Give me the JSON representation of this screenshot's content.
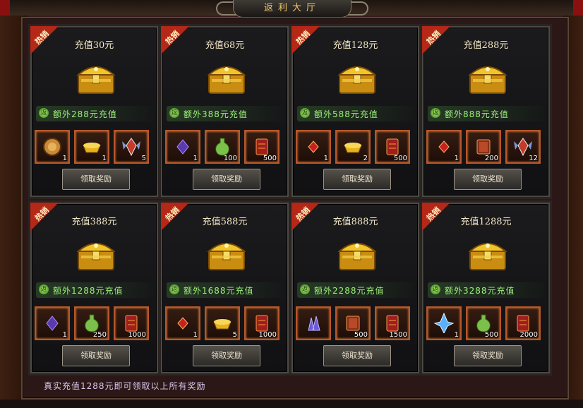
{
  "title": "返利大厅",
  "hot_label": "热销",
  "claim_label": "领取奖励",
  "footer_text": "真实充值1288元即可领取以上所有奖励",
  "cards": [
    {
      "charge": "充值30元",
      "bonus": "额外288元充值",
      "items": [
        {
          "icon": "coin-icon",
          "count": "1"
        },
        {
          "icon": "gold-ingot-icon",
          "count": "1"
        },
        {
          "icon": "winged-emblem-icon",
          "count": "5"
        }
      ]
    },
    {
      "charge": "充值68元",
      "bonus": "额外388元充值",
      "items": [
        {
          "icon": "purple-gem-icon",
          "count": "1"
        },
        {
          "icon": "green-potion-icon",
          "count": "100"
        },
        {
          "icon": "red-scroll-icon",
          "count": "500"
        }
      ]
    },
    {
      "charge": "充值128元",
      "bonus": "额外588元充值",
      "items": [
        {
          "icon": "red-gem-icon",
          "count": "1"
        },
        {
          "icon": "gold-ingot-icon",
          "count": "2"
        },
        {
          "icon": "red-scroll-icon",
          "count": "500"
        }
      ]
    },
    {
      "charge": "充值288元",
      "bonus": "额外888元充值",
      "items": [
        {
          "icon": "red-gem-icon",
          "count": "1"
        },
        {
          "icon": "book-icon",
          "count": "200"
        },
        {
          "icon": "winged-emblem-icon",
          "count": "12"
        }
      ]
    },
    {
      "charge": "充值388元",
      "bonus": "额外1288元充值",
      "items": [
        {
          "icon": "purple-gem-icon",
          "count": "1"
        },
        {
          "icon": "green-potion-icon",
          "count": "250"
        },
        {
          "icon": "red-scroll-icon",
          "count": "1000"
        }
      ]
    },
    {
      "charge": "充值588元",
      "bonus": "额外1688元充值",
      "items": [
        {
          "icon": "red-gem-icon",
          "count": "1"
        },
        {
          "icon": "gold-ingot-icon",
          "count": "5"
        },
        {
          "icon": "red-scroll-icon",
          "count": "1000"
        }
      ]
    },
    {
      "charge": "充值888元",
      "bonus": "额外2288元充值",
      "items": [
        {
          "icon": "crystal-cluster-icon",
          "count": ""
        },
        {
          "icon": "book-icon",
          "count": "500"
        },
        {
          "icon": "red-scroll-icon",
          "count": "1500"
        }
      ]
    },
    {
      "charge": "充值1288元",
      "bonus": "额外3288元充值",
      "items": [
        {
          "icon": "blue-crystal-icon",
          "count": "1"
        },
        {
          "icon": "green-potion-icon",
          "count": "500"
        },
        {
          "icon": "red-scroll-icon",
          "count": "2000"
        }
      ]
    }
  ]
}
